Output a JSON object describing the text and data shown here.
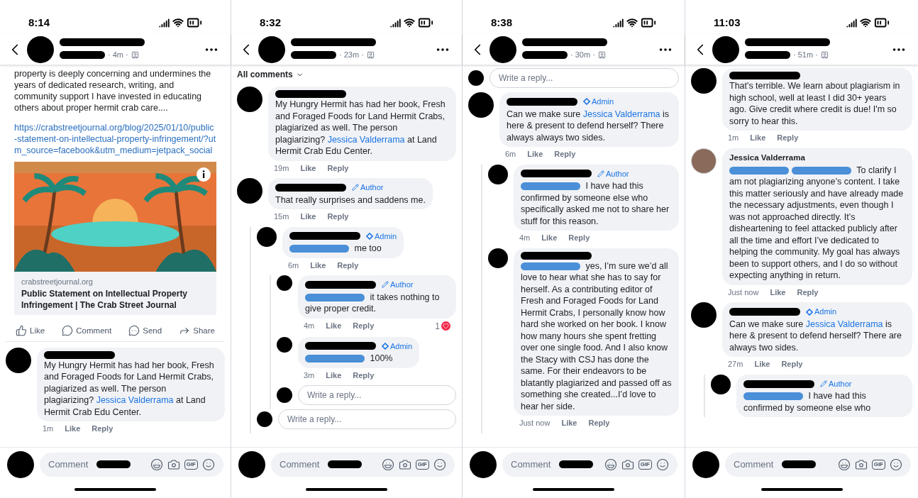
{
  "screens": [
    {
      "status_time": "8:14",
      "post_age": "· 4m ·",
      "feed": [
        {
          "kind": "post_text",
          "text": "property is deeply concerning and undermines the years of dedicated research, writing, and community support I have invested in educating others about proper hermit crab care...."
        },
        {
          "kind": "link",
          "text": "https://crabstreetjournal.org/blog/2025/01/10/public-statement-on-intellectual-property-infringement/?utm_source=facebook&utm_medium=jetpack_social"
        },
        {
          "kind": "link_preview",
          "domain": "crabstreetjournal.org",
          "title": "Public Statement on Intellectual Property Infringement | The Crab Street Journal"
        },
        {
          "kind": "actions",
          "items": [
            {
              "label": "Like"
            },
            {
              "label": "Comment"
            },
            {
              "label": "Send"
            },
            {
              "label": "Share"
            }
          ]
        },
        {
          "kind": "comment",
          "photo_avatar": false,
          "parts": [
            {
              "kind": "plain",
              "text": "My Hungry Hermit has had her book, Fresh and Foraged Foods for Land Hermit Crabs, plagiarized as well. The person plagiarizing? "
            },
            {
              "kind": "mention",
              "text": "Jessica Valderrama"
            },
            {
              "kind": "plain",
              "text": " at Land Hermit Crab Edu Center."
            }
          ],
          "time": "1m",
          "like": "Like",
          "reply": "Reply"
        }
      ],
      "composer": {
        "placeholder": "Comment",
        "gif": "GIF"
      }
    },
    {
      "status_time": "8:32",
      "post_age": "· 23m ·",
      "feed": [
        {
          "kind": "sort",
          "label": "All comments"
        },
        {
          "kind": "comment",
          "photo_avatar": false,
          "parts": [
            {
              "kind": "plain",
              "text": "My Hungry Hermit has had her book, Fresh and Foraged Foods for Land Hermit Crabs, plagiarized as well. The person plagiarizing? "
            },
            {
              "kind": "mention",
              "text": "Jessica Valderrama"
            },
            {
              "kind": "plain",
              "text": " at Land Hermit Crab Edu Center."
            }
          ],
          "time": "19m",
          "like": "Like",
          "reply": "Reply"
        },
        {
          "kind": "comment",
          "photo_avatar": false,
          "badge": {
            "kind": "author",
            "label": "Author"
          },
          "parts": [
            {
              "kind": "plain",
              "text": "That really surprises and saddens me."
            }
          ],
          "time": "15m",
          "like": "Like",
          "reply": "Reply",
          "children": [
            {
              "kind": "comment",
              "photo_avatar": false,
              "badge": {
                "kind": "admin",
                "label": "Admin"
              },
              "parts": [
                {
                  "kind": "redacted"
                },
                {
                  "kind": "plain",
                  "text": " me too"
                }
              ],
              "time": "6m",
              "like": "Like",
              "reply": "Reply",
              "children": [
                {
                  "kind": "comment",
                  "photo_avatar": false,
                  "badge": {
                    "kind": "author",
                    "label": "Author"
                  },
                  "parts": [
                    {
                      "kind": "redacted"
                    },
                    {
                      "kind": "plain",
                      "text": " it takes nothing to give proper credit."
                    }
                  ],
                  "time": "4m",
                  "like": "Like",
                  "reply": "Reply",
                  "reactions": "1"
                },
                {
                  "kind": "comment",
                  "photo_avatar": false,
                  "badge": {
                    "kind": "admin",
                    "label": "Admin"
                  },
                  "parts": [
                    {
                      "kind": "redacted"
                    },
                    {
                      "kind": "plain",
                      "text": " 100%"
                    }
                  ],
                  "time": "3m",
                  "like": "Like",
                  "reply": "Reply"
                },
                {
                  "kind": "reply_field",
                  "placeholder": "Write a reply..."
                }
              ]
            },
            {
              "kind": "reply_field",
              "placeholder": "Write a reply..."
            }
          ]
        }
      ],
      "composer": {
        "placeholder": "Comment",
        "gif": "GIF"
      }
    },
    {
      "status_time": "8:38",
      "post_age": "· 30m ·",
      "feed": [
        {
          "kind": "reply_field",
          "placeholder": "Write a reply..."
        },
        {
          "kind": "comment",
          "photo_avatar": false,
          "badge": {
            "kind": "admin",
            "label": "Admin"
          },
          "parts": [
            {
              "kind": "plain",
              "text": "Can we make sure "
            },
            {
              "kind": "mention",
              "text": "Jessica Valderrama"
            },
            {
              "kind": "plain",
              "text": " is here & present to defend herself? There always always two sides."
            }
          ],
          "time": "6m",
          "like": "Like",
          "reply": "Reply",
          "children": [
            {
              "kind": "comment",
              "photo_avatar": false,
              "badge": {
                "kind": "author",
                "label": "Author"
              },
              "parts": [
                {
                  "kind": "redacted"
                },
                {
                  "kind": "plain",
                  "text": " I have had this confirmed by someone else  who specifically asked me not to share her stuff for this reason."
                }
              ],
              "time": "4m",
              "like": "Like",
              "reply": "Reply"
            },
            {
              "kind": "comment",
              "photo_avatar": false,
              "parts": [
                {
                  "kind": "redacted"
                },
                {
                  "kind": "plain",
                  "text": " yes, I’m sure we’d all love to hear what she has to say for herself. As a contributing editor of Fresh and Foraged Foods for Land Hermit Crabs, I personally know how hard she worked on her book. I know how many hours she spent fretting over one single food. And I also know the Stacy with CSJ has done the same. For their endeavors to be blatantly plagiarized and passed off as something she created...I’d love to hear her side."
                }
              ],
              "time": "Just now",
              "like": "Like",
              "reply": "Reply"
            }
          ]
        }
      ],
      "composer": {
        "placeholder": "Comment",
        "gif": "GIF"
      }
    },
    {
      "status_time": "11:03",
      "post_age": "· 51m ·",
      "feed": [
        {
          "kind": "comment",
          "photo_avatar": false,
          "parts": [
            {
              "kind": "plain",
              "text": "That's terrible.  We learn about plagiarism in high school, well at least I did 30+ years ago. Give credit where credit is due! I'm so sorry to hear this."
            }
          ],
          "time": "1m",
          "like": "Like",
          "reply": "Reply"
        },
        {
          "kind": "comment",
          "photo_avatar": true,
          "name": "Jessica Valderrama",
          "parts": [
            {
              "kind": "redacted"
            },
            {
              "kind": "redacted"
            },
            {
              "kind": "plain",
              "text": " To clarify I am not plagiarizing anyone’s content. I take this matter seriously and have already made the necessary adjustments, even though I was not approached directly. It’s disheartening to feel attacked publicly after all the time and effort I’ve dedicated to helping the community. My goal has always been to support others, and I do so without expecting anything in return."
            }
          ],
          "time": "Just now",
          "like": "Like",
          "reply": "Reply"
        },
        {
          "kind": "comment",
          "photo_avatar": false,
          "badge": {
            "kind": "admin",
            "label": "Admin"
          },
          "parts": [
            {
              "kind": "plain",
              "text": "Can we make sure "
            },
            {
              "kind": "mention",
              "text": "Jessica Valderrama"
            },
            {
              "kind": "plain",
              "text": " is here & present to defend herself? There are always two sides."
            }
          ],
          "time": "27m",
          "like": "Like",
          "reply": "Reply",
          "children": [
            {
              "kind": "comment",
              "photo_avatar": false,
              "badge": {
                "kind": "author",
                "label": "Author"
              },
              "parts": [
                {
                  "kind": "redacted"
                },
                {
                  "kind": "plain",
                  "text": " I have had this confirmed by someone else  who"
                }
              ]
            }
          ]
        }
      ],
      "composer": {
        "placeholder": "Comment",
        "gif": "GIF"
      }
    }
  ]
}
